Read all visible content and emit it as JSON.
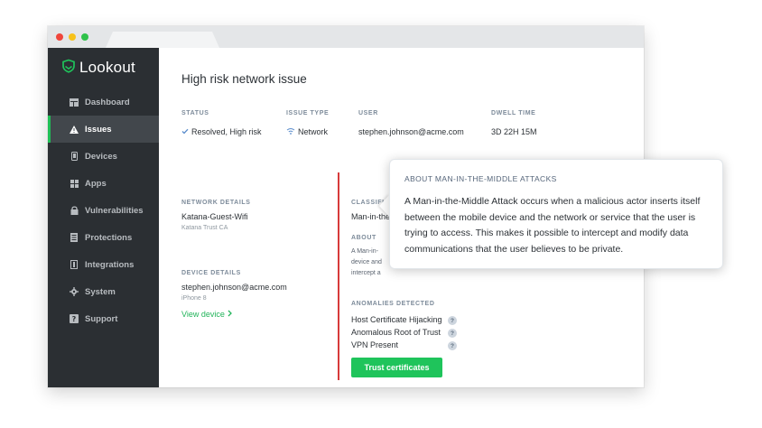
{
  "sidebar": {
    "logo": "Lookout",
    "items": [
      {
        "label": "Dashboard",
        "icon": "dashboard-icon"
      },
      {
        "label": "Issues",
        "icon": "warning-icon",
        "active": true
      },
      {
        "label": "Devices",
        "icon": "phone-icon"
      },
      {
        "label": "Apps",
        "icon": "apps-grid-icon"
      },
      {
        "label": "Vulnerabilities",
        "icon": "lock-icon"
      },
      {
        "label": "Protections",
        "icon": "document-icon"
      },
      {
        "label": "Integrations",
        "icon": "plug-icon"
      },
      {
        "label": "System",
        "icon": "gear-icon"
      },
      {
        "label": "Support",
        "icon": "help-icon"
      }
    ]
  },
  "main": {
    "title": "High risk network issue",
    "columns": {
      "status": {
        "label": "STATUS",
        "value": "Resolved, High risk"
      },
      "issue_type": {
        "label": "ISSUE TYPE",
        "value": "Network"
      },
      "user": {
        "label": "USER",
        "value": "stephen.johnson@acme.com"
      },
      "dwell_time": {
        "label": "DWELL TIME",
        "value": "3D 22H 15M"
      }
    },
    "network_details": {
      "label": "NETWORK DETAILS",
      "name": "Katana-Guest-Wifi",
      "sub": "Katana Trust CA"
    },
    "device_details": {
      "label": "DEVICE DETAILS",
      "email": "stephen.johnson@acme.com",
      "model": "iPhone 8",
      "link": "View device"
    },
    "classification": {
      "label": "CLASSIFICA",
      "value": "Man-in-the"
    },
    "about": {
      "label": "ABOUT",
      "lines": [
        "A Man-in-",
        "device and",
        "intercept a"
      ]
    },
    "anomalies": {
      "label": "ANOMALIES DETECTED",
      "items": [
        "Host Certificate Hijacking",
        "Anomalous Root of Trust",
        "VPN Present"
      ],
      "help_glyph": "?"
    },
    "button": "Trust certificates"
  },
  "popover": {
    "title": "ABOUT MAN-IN-THE-MIDDLE ATTACKS",
    "body": "A Man-in-the-Middle Attack occurs when a malicious actor inserts itself between the mobile device and the network or service that the user is trying to access. This makes it possible to intercept and modify data communications that the user believes to be private."
  },
  "colors": {
    "accent": "#1fc45b",
    "sidebar": "#2b2f33",
    "alert": "#d73a3a"
  }
}
